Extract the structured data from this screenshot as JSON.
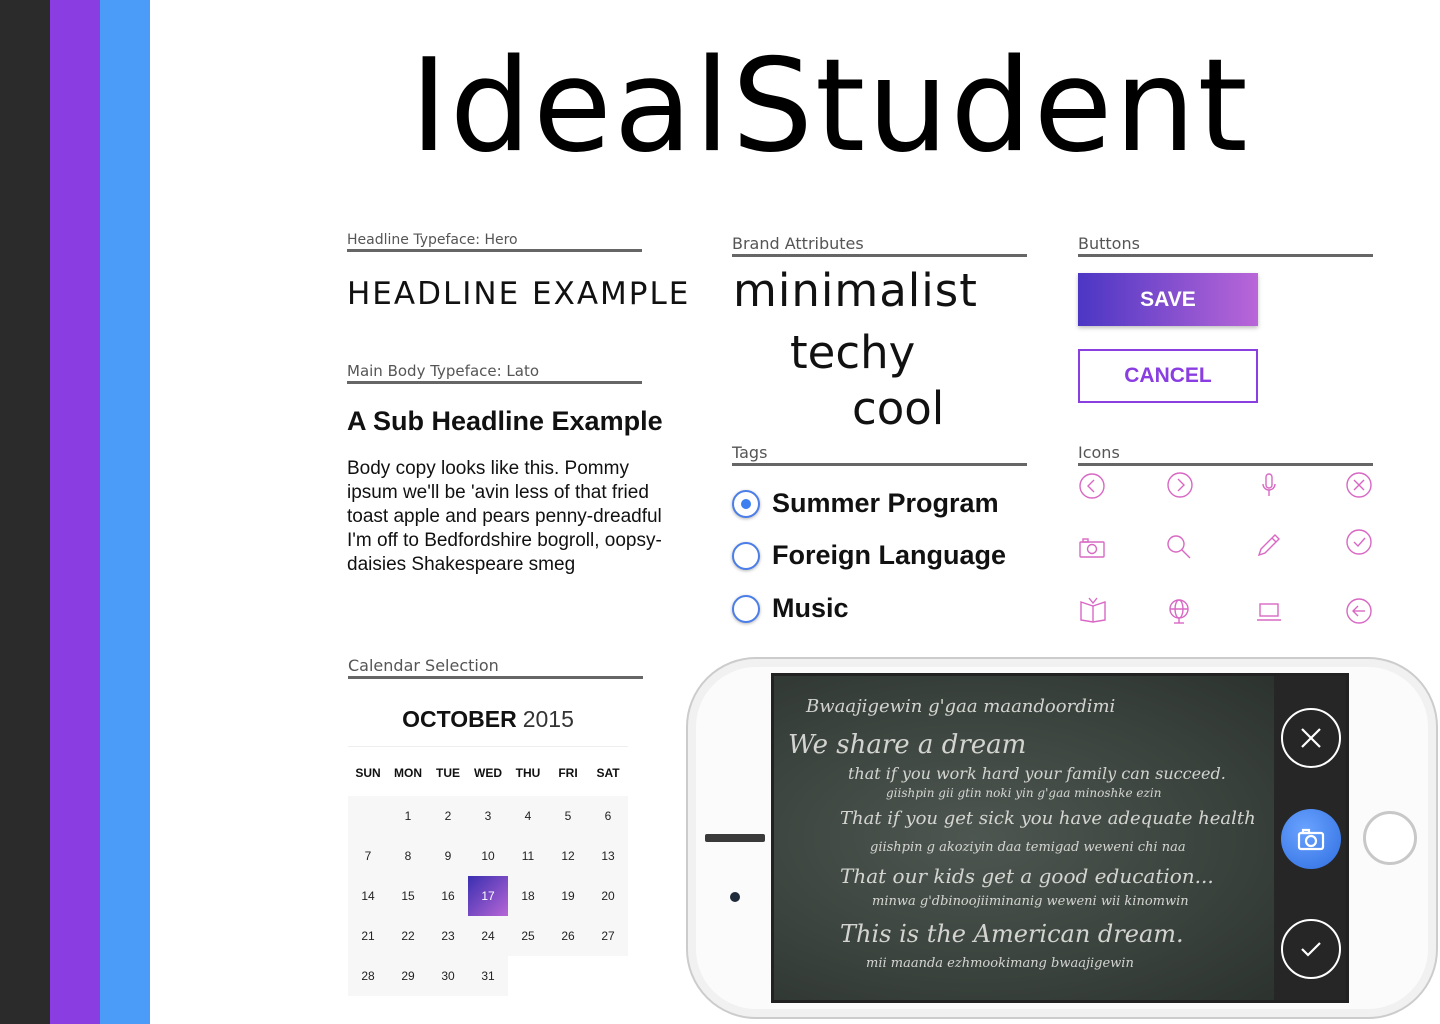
{
  "brand": {
    "title": "IdealStudent",
    "colors": {
      "charcoal": "#2b2b2b",
      "purple": "#8a3de0",
      "blue": "#4b9cf9",
      "icon_pink": "#d868c4"
    }
  },
  "typography": {
    "headline_label": "Headline Typeface:  Hero",
    "headline_example": "HEADLINE EXAMPLE",
    "body_label": "Main Body Typeface:  Lato",
    "sub_headline": "A Sub Headline Example",
    "body_copy": "Body copy looks like this. Pommy ipsum we'll be 'avin less of that fried toast apple and pears penny-dreadful I'm off to Bedfordshire bogroll, oopsy-daisies Shakespeare smeg"
  },
  "attributes": {
    "label": "Brand Attributes",
    "items": [
      "minimalist",
      "techy",
      "cool"
    ]
  },
  "tags": {
    "label": "Tags",
    "items": [
      {
        "label": "Summer Program",
        "checked": true
      },
      {
        "label": "Foreign Language",
        "checked": false
      },
      {
        "label": "Music",
        "checked": false
      }
    ]
  },
  "buttons": {
    "label": "Buttons",
    "save": "SAVE",
    "cancel": "CANCEL"
  },
  "icons": {
    "label": "Icons",
    "items": [
      "chevron-left-circle-icon",
      "chevron-right-circle-icon",
      "microphone-icon",
      "close-circle-icon",
      "camera-icon",
      "search-icon",
      "pencil-icon",
      "check-circle-icon",
      "open-book-icon",
      "globe-icon",
      "laptop-icon",
      "arrow-left-circle-icon"
    ]
  },
  "calendar": {
    "label": "Calendar Selection",
    "month": "OCTOBER",
    "year": "2015",
    "weekdays": [
      "SUN",
      "MON",
      "TUE",
      "WED",
      "THU",
      "FRI",
      "SAT"
    ],
    "first_weekday_index": 1,
    "days_in_month": 31,
    "selected_day": 17
  },
  "phone": {
    "chalk_lines": [
      "Bwaajigewin g'gaa maandoordimi",
      "We share a dream",
      "that if you work hard your family can succeed.",
      "giishpin gii gtin noki yin g'gaa minoshke ezin",
      "That if you get sick you have adequate health",
      "giishpin g akoziyin daa temigad weweni chi naa",
      "That our kids get a good education...",
      "minwa g'dbinoojiiminanig weweni wii kinomwin",
      "This is the American dream.",
      "mii maanda ezhmookimang bwaajigewin"
    ],
    "controls": [
      "close-icon",
      "camera-icon",
      "check-icon"
    ]
  }
}
